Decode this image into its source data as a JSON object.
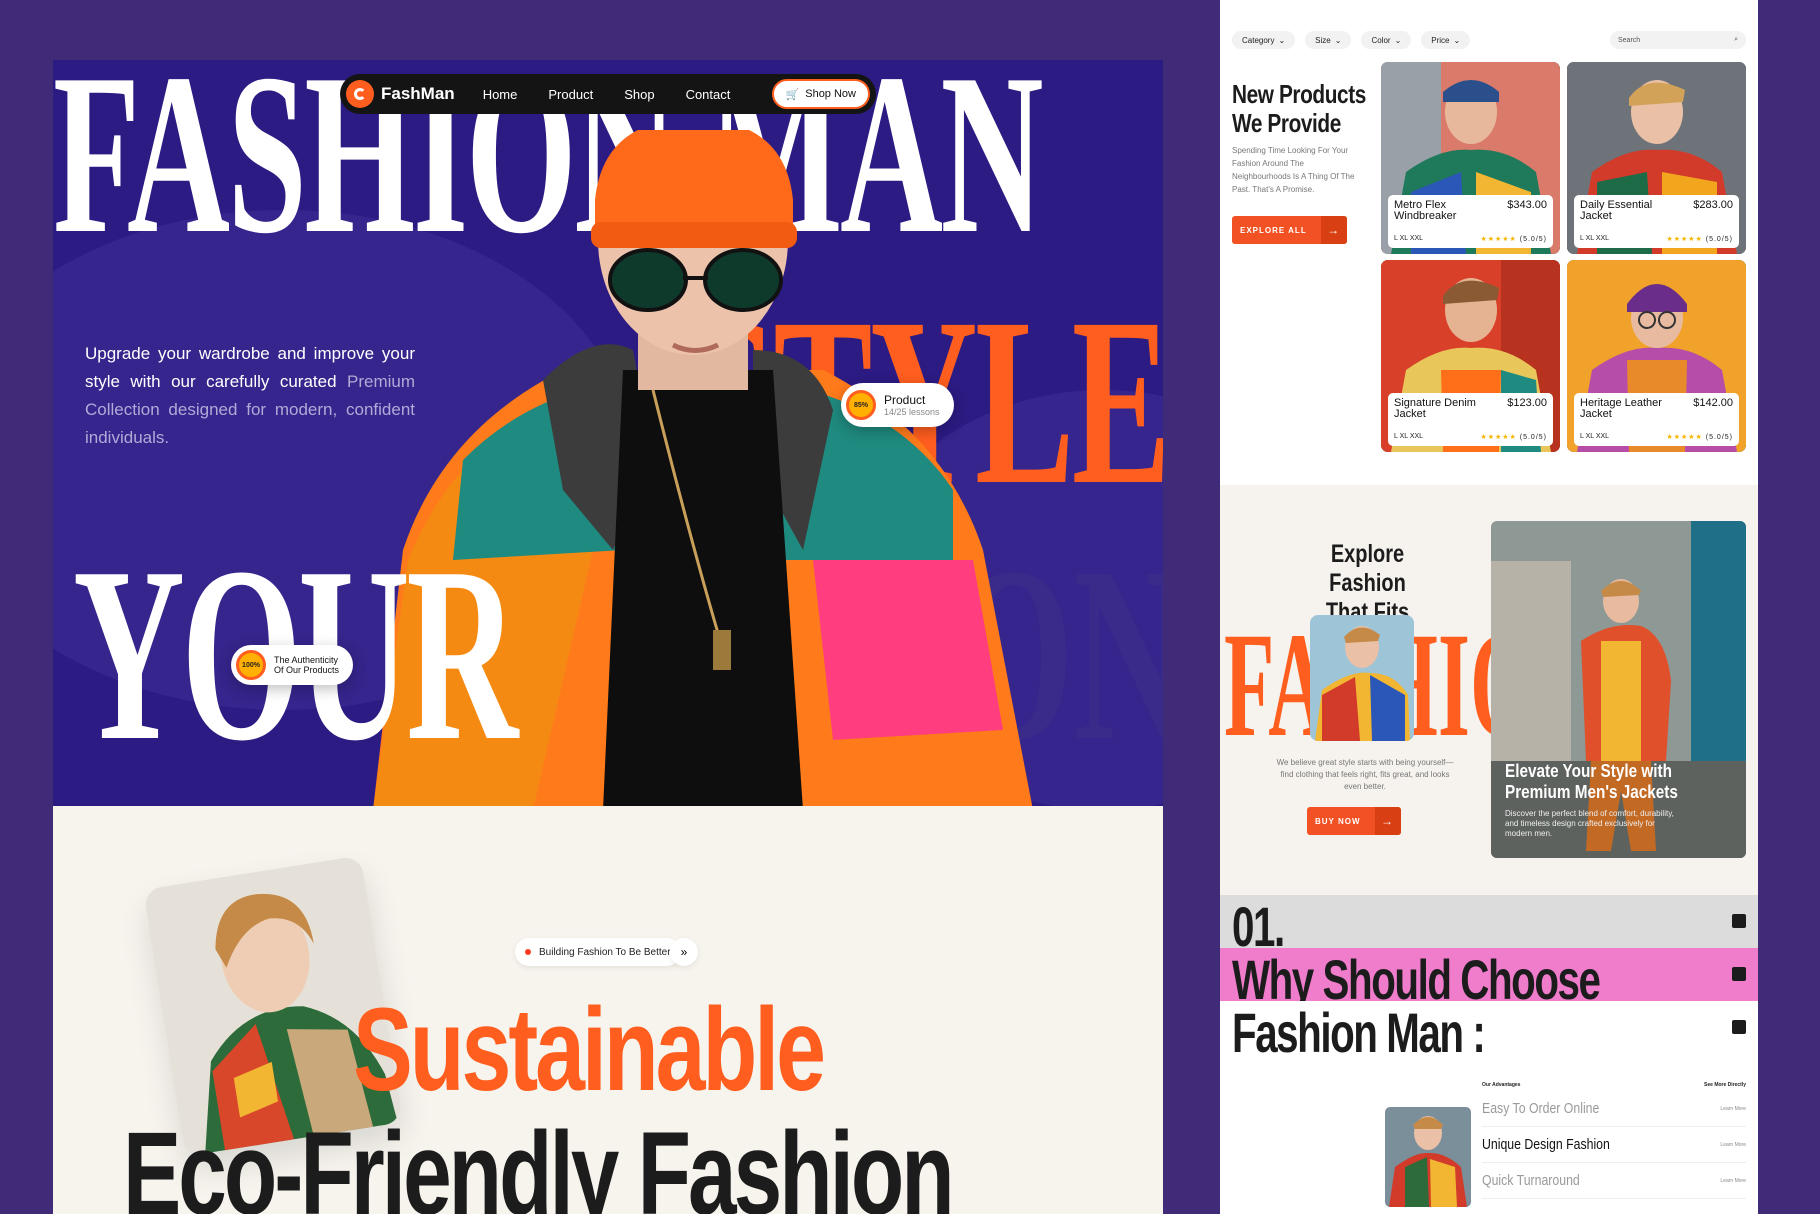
{
  "hero": {
    "word_fashion": "FASHION MAN",
    "word_style": "STYLE",
    "word_your": "YOUR",
    "word_on": "ON",
    "nav": {
      "logo": "FashMan",
      "links": [
        "Home",
        "Product",
        "Shop",
        "Contact"
      ],
      "shop_now": "Shop Now"
    },
    "copy_main": "Upgrade your wardrobe and improve your style with our carefully curated",
    "copy_muted": "Premium Collection designed for modern, confident individuals.",
    "product_pill": {
      "percent": "85%",
      "title": "Product",
      "sub": "14/25 lessons"
    },
    "auth_pill": {
      "percent": "100%",
      "line1": "The Authenticity",
      "line2": "Of Our Products"
    }
  },
  "eco": {
    "badge": "Building Fashion To Be Better",
    "arrow": "»",
    "h1": "Sustainable",
    "h2": "Eco-Friendly Fashion"
  },
  "filters": {
    "items": [
      "Category",
      "Size",
      "Color",
      "Price"
    ],
    "search_placeholder": "Search"
  },
  "new_products": {
    "title_line1": "New Products",
    "title_line2": "We Provide",
    "desc": "Spending Time Looking For Your Fashion Around The Neighbourhoods Is A Thing Of The Past. That's A Promise.",
    "button": "EXPLORE ALL",
    "products": [
      {
        "name": "Metro Flex Windbreaker",
        "price": "$343.00",
        "sizes": "L  XL  XXL",
        "rating": "(5.0/5)"
      },
      {
        "name": "Daily Essential Jacket",
        "price": "$283.00",
        "sizes": "L  XL  XXL",
        "rating": "(5.0/5)"
      },
      {
        "name": "Signature Denim Jacket",
        "price": "$123.00",
        "sizes": "L  XL  XXL",
        "rating": "(5.0/5)"
      },
      {
        "name": "Heritage Leather Jacket",
        "price": "$142.00",
        "sizes": "L  XL  XXL",
        "rating": "(5.0/5)"
      }
    ]
  },
  "explore": {
    "title_line1": "Explore Fashion",
    "title_line2": "That Fits You",
    "big_word": "FASHION",
    "desc": "We believe great style starts with being yourself—find clothing that feels right, fits great, and looks even better.",
    "button": "BUY NOW",
    "photo_title": "Elevate Your Style with Premium Men's Jackets",
    "photo_desc": "Discover the perfect blend of comfort, durability, and timeless design crafted exclusively for modern men."
  },
  "why": {
    "line1": "01.",
    "line2": "Why Should Choose",
    "line3": "Fashion Man :",
    "col_left": "Our Advantages",
    "col_right": "See More Directly",
    "items": [
      {
        "label": "Easy To Order Online",
        "link": "Learn More",
        "active": false
      },
      {
        "label": "Unique Design Fashion",
        "link": "Learn More",
        "active": true
      },
      {
        "label": "Quick Turnaround",
        "link": "Learn More",
        "active": false
      }
    ]
  },
  "colors": {
    "accent": "#ff5e1f",
    "hero_bg": "#2b1b83",
    "page_bg": "#3f2b78",
    "pink": "#f07ccc"
  }
}
